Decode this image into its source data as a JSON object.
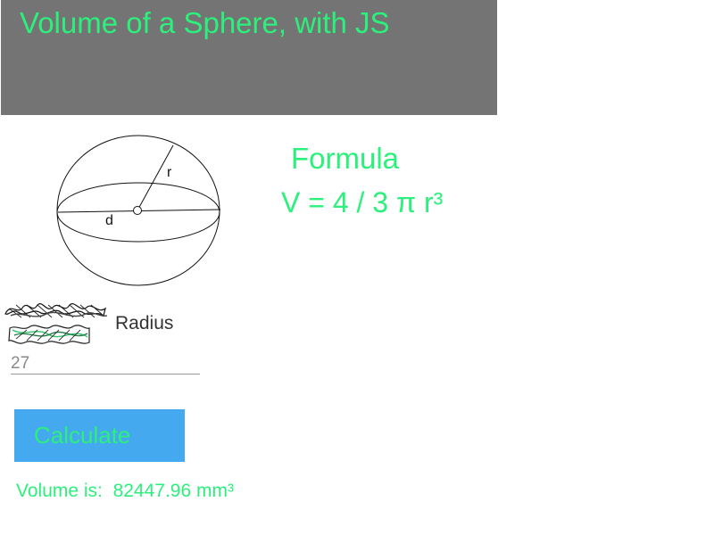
{
  "header": {
    "title": "Volume of a Sphere, with JS",
    "background_color": "#747474",
    "title_color": "#2cf07c"
  },
  "diagram": {
    "radius_label": "r",
    "diameter_label": "d"
  },
  "formula": {
    "title": "Formula",
    "expression": "V = 4 / 3 π r³"
  },
  "form": {
    "radius_label": "Radius",
    "radius_placeholder": "27",
    "calculate_label": "Calculate",
    "button_color": "#44a9ee"
  },
  "result": {
    "prefix": "Volume is:",
    "value": "82447.96",
    "unit": "mm³"
  },
  "colors": {
    "accent": "#2cf07c",
    "label": "#333333"
  }
}
